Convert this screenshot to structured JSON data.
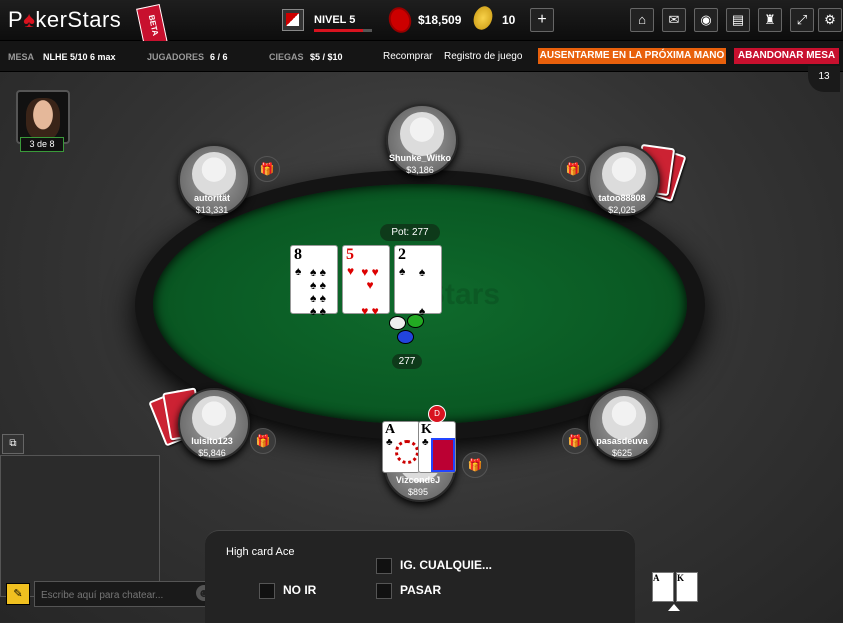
{
  "topbar": {
    "logo_a": "P",
    "logo_b": "kerStars",
    "beta": "BETA",
    "level": "NIVEL 5",
    "level_progress": 0.85,
    "balance": "$18,509",
    "coins": "10",
    "plus": "+",
    "icons": [
      "home-icon",
      "mail-icon",
      "rewards-icon",
      "cashier-icon",
      "lobby-icon",
      "fullscreen-icon",
      "settings-icon"
    ]
  },
  "info": {
    "mesa_label": "MESA",
    "mesa_value": "NLHE 5/10 6 max",
    "jugadores_label": "JUGADORES",
    "jugadores_value": "6 / 6",
    "ciegas_label": "CIEGAS",
    "ciegas_value": "$5 / $10",
    "recomprar": "Recomprar",
    "registro": "Registro de juego",
    "sit_out": "AUSENTARME EN LA PRÓXIMA MANO",
    "leave": "ABANDONAR MESA",
    "corner_count": "13"
  },
  "left": {
    "page_badge": "3 de 8",
    "chat_placeholder": "Escribe aquí para chatear..."
  },
  "table": {
    "pot_label": "Pot:",
    "pot_value": "277",
    "bet_value": "277",
    "felt_logo": "Stars",
    "dealer": "D",
    "board": [
      {
        "rank": "8",
        "suit": "♠",
        "color": "#000000"
      },
      {
        "rank": "5",
        "suit": "♥",
        "color": "#dd0000"
      },
      {
        "rank": "2",
        "suit": "♠",
        "color": "#000000"
      }
    ],
    "hero_cards": [
      {
        "rank": "A",
        "suit": "♣"
      },
      {
        "rank": "K",
        "suit": "♣"
      }
    ]
  },
  "players": [
    {
      "name": "Shunke_Witko",
      "stack": "$3,186"
    },
    {
      "name": "autorität",
      "stack": "$13,331"
    },
    {
      "name": "tatoo88808",
      "stack": "$2,025"
    },
    {
      "name": "luisito123",
      "stack": "$5,846"
    },
    {
      "name": "pasasdeuva",
      "stack": "$625"
    },
    {
      "name": "VizcondeJ",
      "stack": "$895"
    }
  ],
  "actions": {
    "hand_desc": "High card Ace",
    "fold": "NO IR",
    "call_any": "IG. CUALQUIE...",
    "check": "PASAR"
  },
  "mini_cards": [
    "A",
    "K"
  ]
}
